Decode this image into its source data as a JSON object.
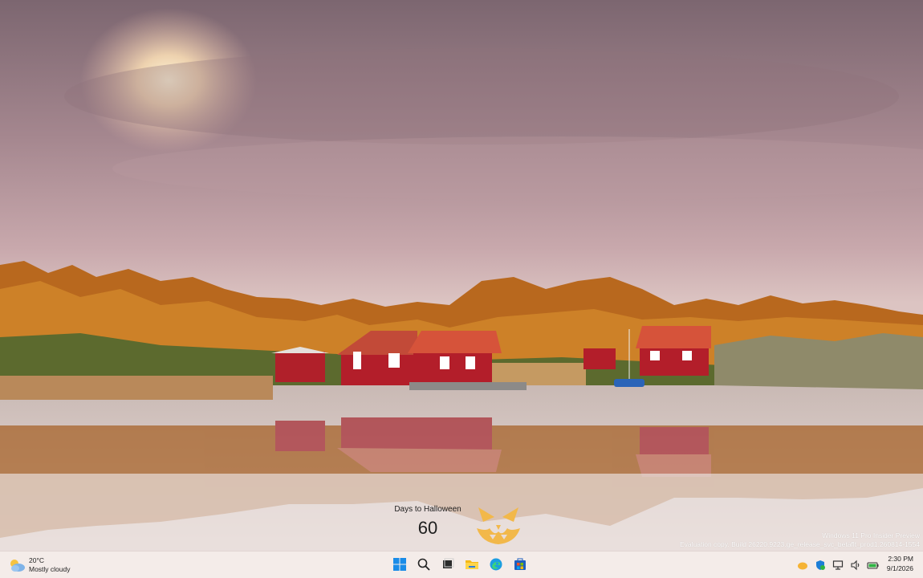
{
  "widget": {
    "label": "Days to Halloween",
    "value": "60"
  },
  "watermark": {
    "line1": "Windows 11 Pro Insider Preview",
    "line2": "Evaluation copy. Build 26220.9223.ge_release_svc_betaflt_prod1.260814-1554"
  },
  "taskbar": {
    "weather": {
      "temp": "20°C",
      "condition": "Mostly cloudy",
      "icon": "partly-cloudy-icon"
    },
    "pinned": [
      {
        "name": "start-button",
        "icon": "windows-logo-icon"
      },
      {
        "name": "search-button",
        "icon": "search-icon"
      },
      {
        "name": "task-view-button",
        "icon": "task-view-icon"
      },
      {
        "name": "file-explorer-button",
        "icon": "folder-icon"
      },
      {
        "name": "edge-button",
        "icon": "edge-icon"
      },
      {
        "name": "store-button",
        "icon": "store-icon"
      }
    ],
    "tray": [
      "weather-alert-icon",
      "security-icon",
      "network-icon",
      "volume-icon",
      "battery-icon"
    ],
    "clock": {
      "time": "2:30 PM",
      "date": "9/1/2026"
    }
  },
  "colors": {
    "accent": "#0078d4",
    "pumpkin": "#f2b84a",
    "taskbar": "#f4ece9"
  }
}
